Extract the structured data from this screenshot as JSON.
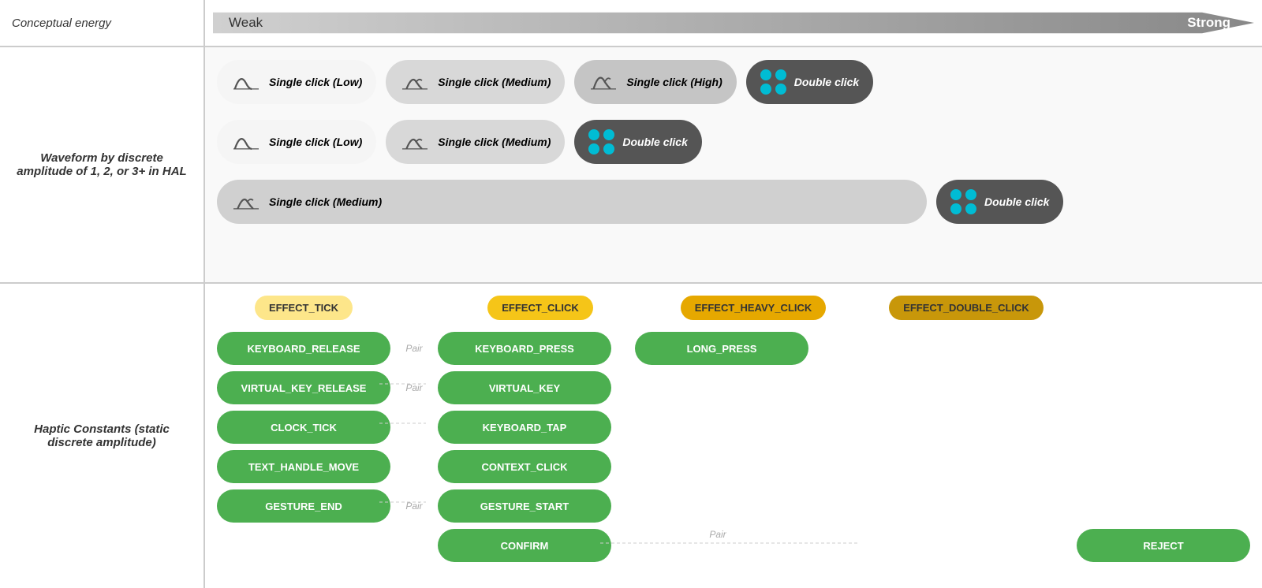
{
  "labels": {
    "conceptual_energy": "Conceptual energy",
    "weak": "Weak",
    "strong": "Strong",
    "waveform": "Waveform by discrete amplitude of 1, 2, or 3+ in HAL",
    "haptic": "Haptic Constants (static discrete amplitude)"
  },
  "waveforms": {
    "row1": [
      {
        "label": "Single click (Low)",
        "type": "low"
      },
      {
        "label": "Single click (Medium)",
        "type": "medium"
      },
      {
        "label": "Single click (High)",
        "type": "high"
      },
      {
        "label": "Double click",
        "type": "double"
      }
    ],
    "row2": [
      {
        "label": "Single click (Low)",
        "type": "low"
      },
      {
        "label": "Single click (Medium)",
        "type": "medium"
      },
      {
        "label": "Double click",
        "type": "double"
      }
    ],
    "row3": [
      {
        "label": "Single click (Medium)",
        "type": "medium"
      },
      {
        "label": "Double click",
        "type": "double"
      }
    ]
  },
  "effects": {
    "tick": "EFFECT_TICK",
    "click": "EFFECT_CLICK",
    "heavy_click": "EFFECT_HEAVY_CLICK",
    "double_click": "EFFECT_DOUBLE_CLICK"
  },
  "constants": {
    "col1": [
      "KEYBOARD_RELEASE",
      "VIRTUAL_KEY_RELEASE",
      "CLOCK_TICK",
      "TEXT_HANDLE_MOVE",
      "GESTURE_END"
    ],
    "col2": [
      "KEYBOARD_PRESS",
      "VIRTUAL_KEY",
      "KEYBOARD_TAP",
      "CONTEXT_CLICK",
      "GESTURE_START",
      "CONFIRM"
    ],
    "col3": [
      "LONG_PRESS"
    ],
    "col4": [
      "REJECT"
    ],
    "pairs": [
      "Pair",
      "Pair",
      "",
      "",
      "Pair"
    ],
    "confirm_reject_pair": "Pair"
  }
}
